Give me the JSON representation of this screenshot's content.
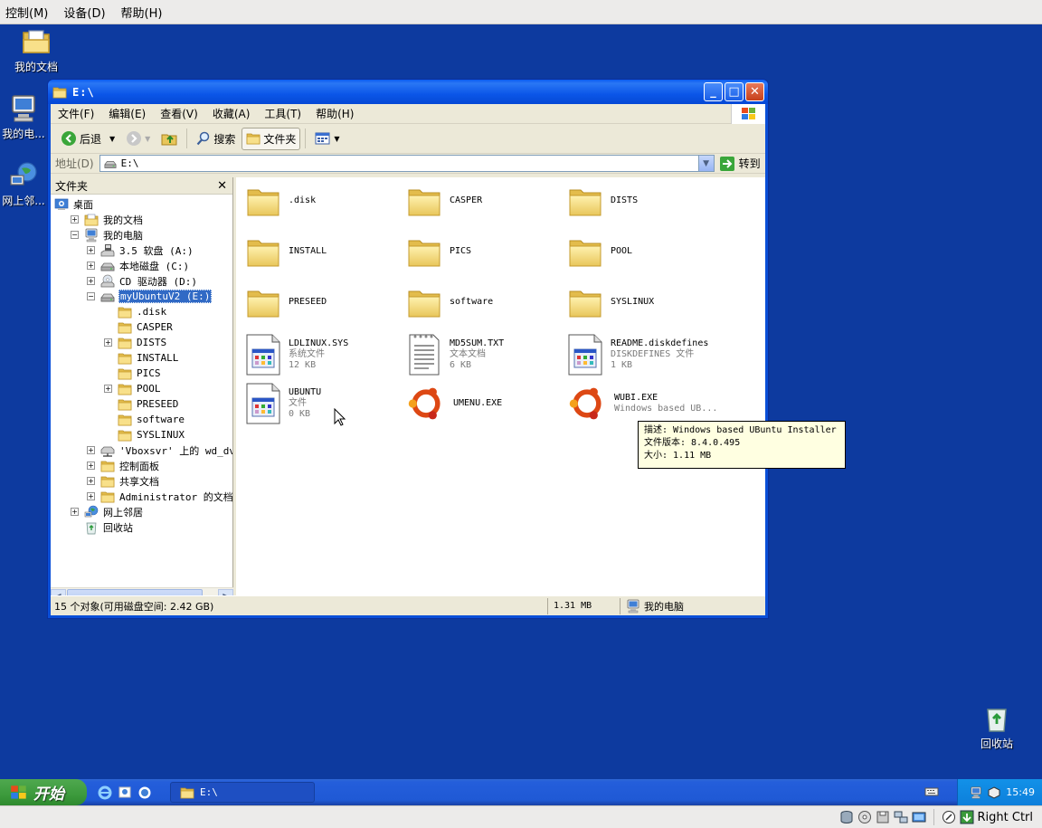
{
  "vbox_menu": [
    "控制(M)",
    "设备(D)",
    "帮助(H)"
  ],
  "desktop_icons": {
    "my_documents": "我的文档",
    "my_computer": "我的电...",
    "network": "网上邻...",
    "recycle_bin": "回收站"
  },
  "window": {
    "title": "E:\\",
    "menus": [
      "文件(F)",
      "编辑(E)",
      "查看(V)",
      "收藏(A)",
      "工具(T)",
      "帮助(H)"
    ],
    "toolbar": {
      "back": "后退",
      "search": "搜索",
      "folders": "文件夹"
    },
    "address_label": "地址(D)",
    "address_value": "E:\\",
    "goto": "转到",
    "folder_pane_title": "文件夹"
  },
  "tree": [
    {
      "label": "桌面",
      "level": 0,
      "exp": "",
      "icon": "desktop"
    },
    {
      "label": "我的文档",
      "level": 1,
      "exp": "+",
      "icon": "mydocs"
    },
    {
      "label": "我的电脑",
      "level": 1,
      "exp": "-",
      "icon": "computer"
    },
    {
      "label": "3.5 软盘 (A:)",
      "level": 2,
      "exp": "+",
      "icon": "floppy"
    },
    {
      "label": "本地磁盘 (C:)",
      "level": 2,
      "exp": "+",
      "icon": "drive"
    },
    {
      "label": "CD 驱动器 (D:)",
      "level": 2,
      "exp": "+",
      "icon": "cd"
    },
    {
      "label": "myUbuntuV2 (E:)",
      "level": 2,
      "exp": "-",
      "icon": "drive",
      "selected": true
    },
    {
      "label": ".disk",
      "level": 3,
      "exp": "",
      "icon": "folder"
    },
    {
      "label": "CASPER",
      "level": 3,
      "exp": "",
      "icon": "folder"
    },
    {
      "label": "DISTS",
      "level": 3,
      "exp": "+",
      "icon": "folder"
    },
    {
      "label": "INSTALL",
      "level": 3,
      "exp": "",
      "icon": "folder"
    },
    {
      "label": "PICS",
      "level": 3,
      "exp": "",
      "icon": "folder"
    },
    {
      "label": "POOL",
      "level": 3,
      "exp": "+",
      "icon": "folder"
    },
    {
      "label": "PRESEED",
      "level": 3,
      "exp": "",
      "icon": "folder"
    },
    {
      "label": "software",
      "level": 3,
      "exp": "",
      "icon": "folder"
    },
    {
      "label": "SYSLINUX",
      "level": 3,
      "exp": "",
      "icon": "folder"
    },
    {
      "label": "'Vboxsvr' 上的 wd_dv (Z",
      "level": 2,
      "exp": "+",
      "icon": "netdrive"
    },
    {
      "label": "控制面板",
      "level": 2,
      "exp": "+",
      "icon": "folder"
    },
    {
      "label": "共享文档",
      "level": 2,
      "exp": "+",
      "icon": "folder"
    },
    {
      "label": "Administrator 的文档",
      "level": 2,
      "exp": "+",
      "icon": "folder"
    },
    {
      "label": "网上邻居",
      "level": 1,
      "exp": "+",
      "icon": "network"
    },
    {
      "label": "回收站",
      "level": 1,
      "exp": "",
      "icon": "recycle"
    }
  ],
  "files": [
    {
      "name": ".disk",
      "type": "folder"
    },
    {
      "name": "CASPER",
      "type": "folder"
    },
    {
      "name": "DISTS",
      "type": "folder"
    },
    {
      "name": "INSTALL",
      "type": "folder"
    },
    {
      "name": "PICS",
      "type": "folder"
    },
    {
      "name": "POOL",
      "type": "folder"
    },
    {
      "name": "PRESEED",
      "type": "folder"
    },
    {
      "name": "software",
      "type": "folder"
    },
    {
      "name": "SYSLINUX",
      "type": "folder"
    },
    {
      "name": "LDLINUX.SYS",
      "type": "sysfile",
      "sub1": "系统文件",
      "sub2": "12 KB"
    },
    {
      "name": "MD5SUM.TXT",
      "type": "text",
      "sub1": "文本文档",
      "sub2": "6 KB"
    },
    {
      "name": "README.diskdefines",
      "type": "sysfile",
      "sub1": "DISKDEFINES 文件",
      "sub2": "1 KB"
    },
    {
      "name": "UBUNTU",
      "type": "sysfile",
      "sub1": "文件",
      "sub2": "0 KB"
    },
    {
      "name": "UMENU.EXE",
      "type": "ubuntu"
    },
    {
      "name": "WUBI.EXE",
      "type": "ubuntu",
      "sub1": "Windows based UB..."
    }
  ],
  "tooltip": {
    "line1": "描述: Windows based UBuntu Installer",
    "line2": "文件版本: 8.4.0.495",
    "line3": "大小: 1.11 MB"
  },
  "status": {
    "objects": "15 个对象(可用磁盘空间: 2.42 GB)",
    "size": "1.31 MB",
    "location": "我的电脑"
  },
  "taskbar": {
    "start": "开始",
    "task_title": "E:\\",
    "clock": "15:49"
  },
  "vbox_status": {
    "host_key": "Right Ctrl"
  },
  "colors": {
    "desktop": "#0d3a9f",
    "titlebar": "#0a5cf0",
    "selection": "#316ac5",
    "tooltip": "#ffffe1"
  }
}
